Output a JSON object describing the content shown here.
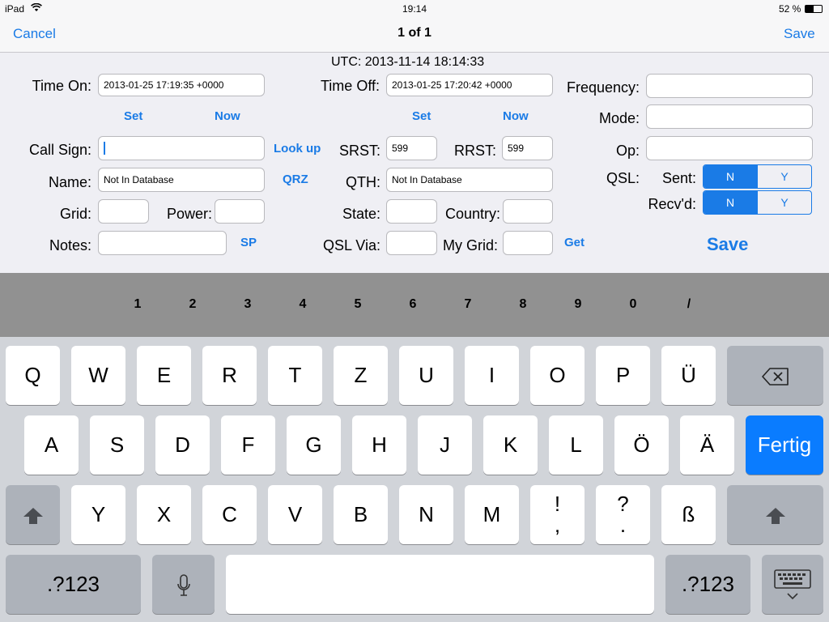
{
  "status_bar": {
    "device": "iPad",
    "time": "19:14",
    "battery": "52 %"
  },
  "nav": {
    "cancel": "Cancel",
    "title": "1 of 1",
    "save": "Save"
  },
  "form": {
    "utc": "UTC: 2013-11-14 18:14:33",
    "time_on_label": "Time On:",
    "time_on_value": "2013-01-25 17:19:35 +0000",
    "time_off_label": "Time Off:",
    "time_off_value": "2013-01-25 17:20:42 +0000",
    "set": "Set",
    "now": "Now",
    "frequency_label": "Frequency:",
    "frequency_value": "",
    "mode_label": "Mode:",
    "mode_value": "",
    "call_sign_label": "Call Sign:",
    "call_sign_value": "",
    "look_up": "Look up",
    "srst_label": "SRST:",
    "srst_value": "599",
    "rrst_label": "RRST:",
    "rrst_value": "599",
    "op_label": "Op:",
    "op_value": "",
    "name_label": "Name:",
    "name_value": "Not In Database",
    "qrz": "QRZ",
    "qth_label": "QTH:",
    "qth_value": "Not In Database",
    "qsl_label": "QSL:",
    "sent_label": "Sent:",
    "recvd_label": "Recv'd:",
    "seg_n": "N",
    "seg_y": "Y",
    "grid_label": "Grid:",
    "grid_value": "",
    "power_label": "Power:",
    "power_value": "",
    "state_label": "State:",
    "state_value": "",
    "country_label": "Country:",
    "country_value": "",
    "notes_label": "Notes:",
    "notes_value": "",
    "sp": "SP",
    "qsl_via_label": "QSL Via:",
    "qsl_via_value": "",
    "my_grid_label": "My Grid:",
    "my_grid_value": "",
    "get": "Get",
    "save_big": "Save"
  },
  "number_row": [
    "1",
    "2",
    "3",
    "4",
    "5",
    "6",
    "7",
    "8",
    "9",
    "0",
    "/"
  ],
  "keyboard": {
    "row1": [
      "Q",
      "W",
      "E",
      "R",
      "T",
      "Z",
      "U",
      "I",
      "O",
      "P",
      "Ü"
    ],
    "row2": [
      "A",
      "S",
      "D",
      "F",
      "G",
      "H",
      "J",
      "K",
      "L",
      "Ö",
      "Ä"
    ],
    "row3": [
      "Y",
      "X",
      "C",
      "V",
      "B",
      "N",
      "M"
    ],
    "excl_top": "!",
    "excl_bottom": ",",
    "quest_top": "?",
    "quest_bottom": ".",
    "eszett": "ß",
    "done": "Fertig",
    "numbers": ".?123",
    "backspace_icon": "⌫",
    "shift_icon": "⬆",
    "mic_icon": "🎙",
    "hide_keyboard_icon": "⌨"
  }
}
